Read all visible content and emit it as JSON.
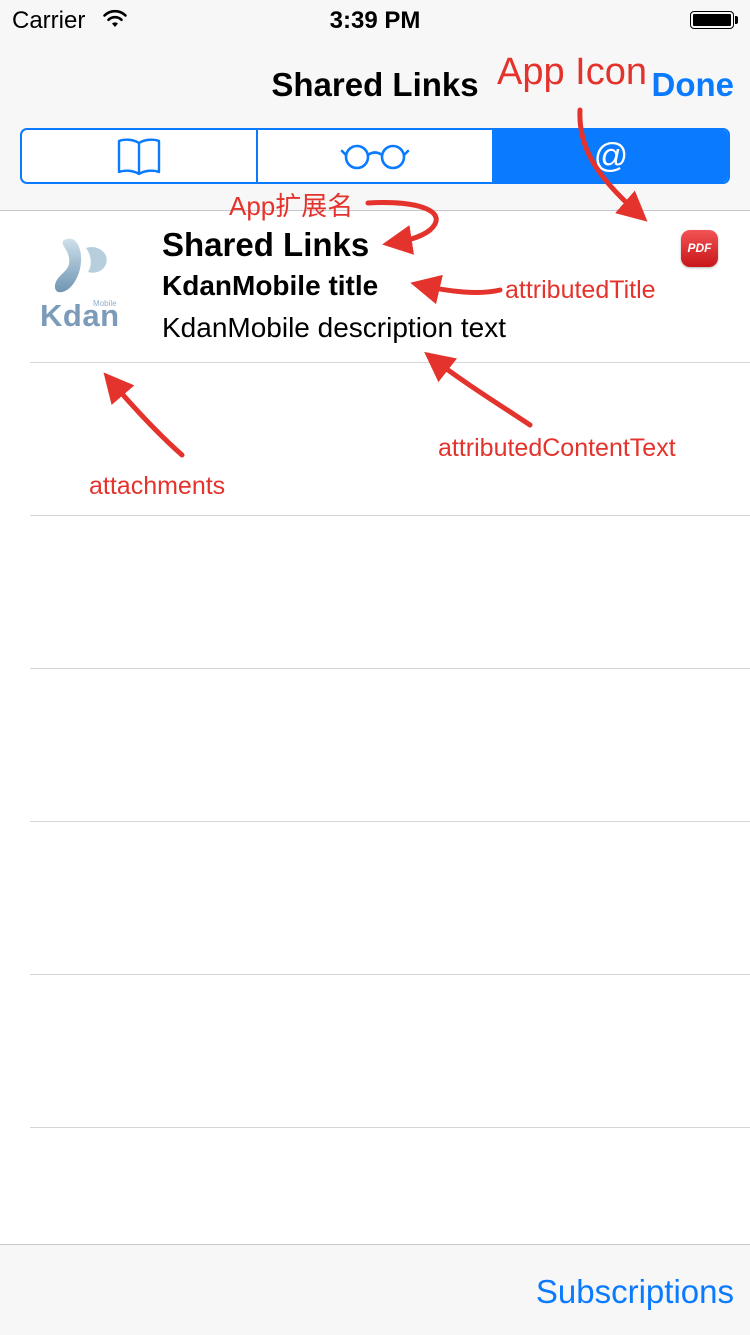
{
  "status_bar": {
    "carrier": "Carrier",
    "time": "3:39 PM",
    "battery_icon": "battery-full-icon",
    "wifi_icon": "wifi-icon"
  },
  "nav": {
    "title": "Shared Links",
    "done_label": "Done"
  },
  "segments": [
    {
      "icon": "book-icon",
      "selected": false
    },
    {
      "icon": "glasses-icon",
      "selected": false
    },
    {
      "icon": "at-sign-icon",
      "selected": true
    }
  ],
  "row": {
    "title": "Shared Links",
    "subtitle": "KdanMobile title",
    "description": "KdanMobile description text",
    "attachment": {
      "brand": "Kdan",
      "tag": "Mobile"
    },
    "app_icon": {
      "label": "PDF",
      "color": "#e0272a"
    }
  },
  "annotations": {
    "app_icon": "App Icon",
    "app_extension": "App扩展名",
    "attributed_title": "attributedTitle",
    "attributed_content": "attributedContentText",
    "attachments": "attachments",
    "color": "#e4332c"
  },
  "toolbar": {
    "subscriptions_label": "Subscriptions"
  },
  "colors": {
    "accent": "#0a7aff",
    "bar_background": "#f7f7f7"
  }
}
